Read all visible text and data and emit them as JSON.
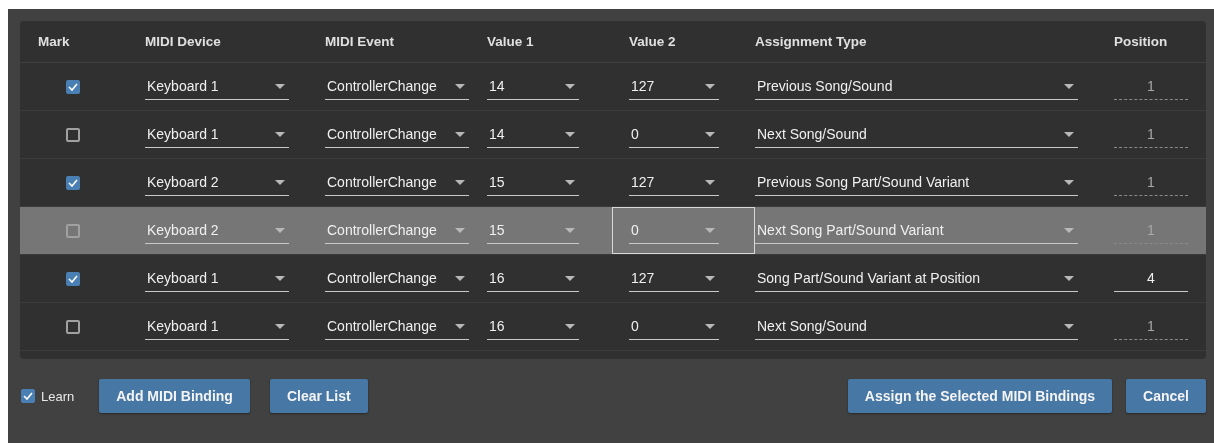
{
  "table": {
    "columns": [
      "Mark",
      "MIDI Device",
      "MIDI Event",
      "Value 1",
      "Value 2",
      "Assignment Type",
      "Position"
    ],
    "rows": [
      {
        "checked": true,
        "selected": false,
        "device": "Keyboard 1",
        "event": "ControllerChange",
        "value_1": "14",
        "value_2": {
          "text": "127",
          "focused": false
        },
        "assignment": "Previous Song/Sound",
        "position": {
          "text": "1",
          "disabled": true
        }
      },
      {
        "checked": false,
        "selected": false,
        "device": "Keyboard 1",
        "event": "ControllerChange",
        "value_1": "14",
        "value_2": {
          "text": "0",
          "focused": false
        },
        "assignment": "Next Song/Sound",
        "position": {
          "text": "1",
          "disabled": true
        }
      },
      {
        "checked": true,
        "selected": false,
        "device": "Keyboard 2",
        "event": "ControllerChange",
        "value_1": "15",
        "value_2": {
          "text": "127",
          "focused": false
        },
        "assignment": "Previous Song Part/Sound Variant",
        "position": {
          "text": "1",
          "disabled": true
        }
      },
      {
        "checked": false,
        "selected": true,
        "device": "Keyboard 2",
        "event": "ControllerChange",
        "value_1": "15",
        "value_2": {
          "text": "0",
          "focused": true
        },
        "assignment": "Next Song Part/Sound Variant",
        "position": {
          "text": "1",
          "disabled": true
        }
      },
      {
        "checked": true,
        "selected": false,
        "device": "Keyboard 1",
        "event": "ControllerChange",
        "value_1": "16",
        "value_2": {
          "text": "127",
          "focused": false
        },
        "assignment": "Song Part/Sound Variant at Position",
        "position": {
          "text": "4",
          "disabled": false
        }
      },
      {
        "checked": false,
        "selected": false,
        "device": "Keyboard 1",
        "event": "ControllerChange",
        "value_1": "16",
        "value_2": {
          "text": "0",
          "focused": false
        },
        "assignment": "Next Song/Sound",
        "position": {
          "text": "1",
          "disabled": true
        }
      }
    ]
  },
  "footer": {
    "learn": {
      "label": "Learn",
      "checked": true
    },
    "left_buttons": [
      "Add MIDI Binding",
      "Clear List"
    ],
    "right_buttons": [
      "Assign the Selected MIDI Bindings",
      "Cancel"
    ]
  }
}
